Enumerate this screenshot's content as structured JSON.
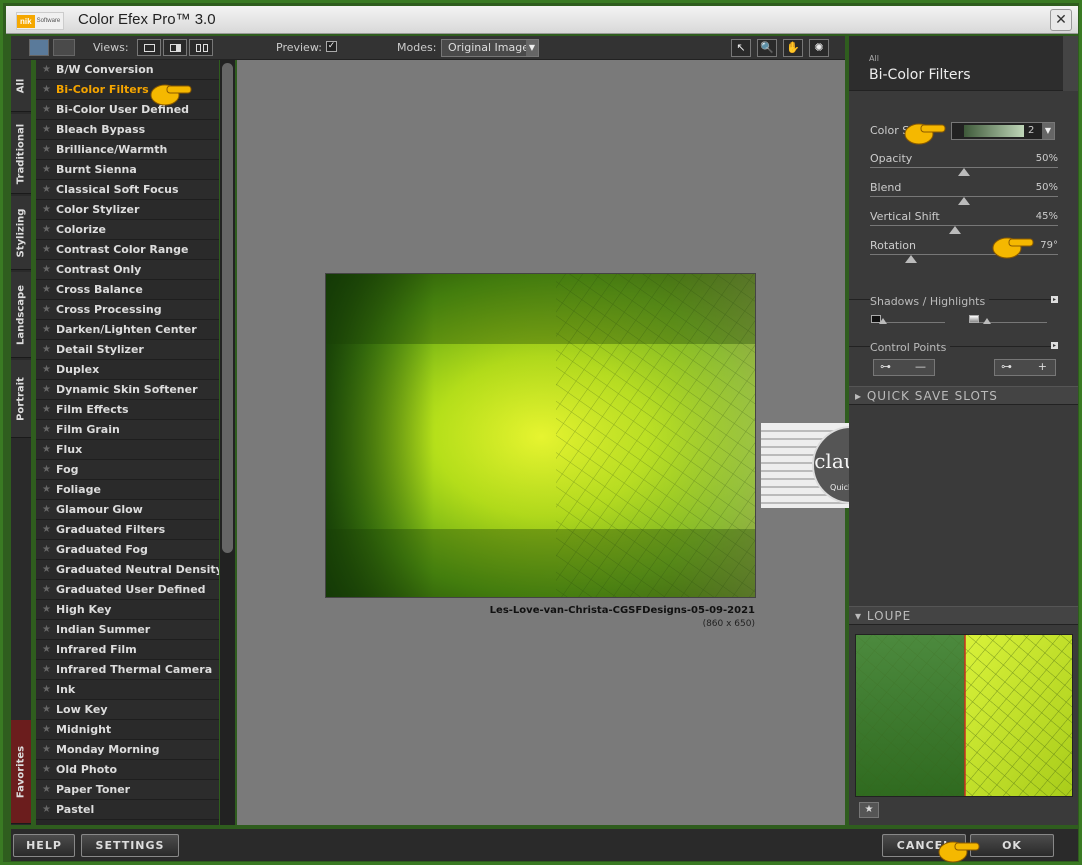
{
  "window": {
    "logo_mark": "nik",
    "logo_sub": "Software",
    "title": "Color Efex Pro™ 3.0",
    "close_glyph": "✕"
  },
  "toolbar": {
    "views_label": "Views:",
    "preview_label": "Preview:",
    "preview_checked_glyph": "✓",
    "modes_label": "Modes:",
    "mode_value": "Original Image",
    "dropdown_glyph": "▼",
    "tools": [
      {
        "name": "pointer-icon",
        "glyph": "↖"
      },
      {
        "name": "zoom-icon",
        "glyph": "🔍"
      },
      {
        "name": "hand-icon",
        "glyph": "✋"
      },
      {
        "name": "light-icon",
        "glyph": "✺"
      }
    ]
  },
  "category_tabs": [
    "All",
    "Traditional",
    "Stylizing",
    "Landscape",
    "Portrait",
    "Favorites"
  ],
  "filters": {
    "selected_index": 1,
    "items": [
      "B/W Conversion",
      "Bi-Color Filters",
      "Bi-Color User Defined",
      "Bleach Bypass",
      "Brilliance/Warmth",
      "Burnt Sienna",
      "Classical Soft Focus",
      "Color Stylizer",
      "Colorize",
      "Contrast Color Range",
      "Contrast Only",
      "Cross Balance",
      "Cross Processing",
      "Darken/Lighten Center",
      "Detail Stylizer",
      "Duplex",
      "Dynamic Skin Softener",
      "Film Effects",
      "Film Grain",
      "Flux",
      "Fog",
      "Foliage",
      "Glamour Glow",
      "Graduated Filters",
      "Graduated Fog",
      "Graduated Neutral Density",
      "Graduated User Defined",
      "High Key",
      "Indian Summer",
      "Infrared Film",
      "Infrared Thermal Camera",
      "Ink",
      "Low Key",
      "Midnight",
      "Monday Morning",
      "Old Photo",
      "Paper Toner",
      "Pastel"
    ]
  },
  "preview": {
    "file_name": "Les-Love-van-Christa-CGSFDesigns-05-09-2021",
    "dimensions": "(860 x 650)"
  },
  "watermark": {
    "name": "claudia",
    "sub": "Quick love"
  },
  "panel": {
    "breadcrumb": "All",
    "title": "Bi-Color Filters",
    "color_set_label": "Color S",
    "color_set_value": "2",
    "sliders": [
      {
        "label": "Opacity",
        "display": "50%",
        "value": 0.5
      },
      {
        "label": "Blend",
        "display": "50%",
        "value": 0.5
      },
      {
        "label": "Vertical Shift",
        "display": "45%",
        "value": 0.45
      },
      {
        "label": "Rotation",
        "display": "79°",
        "value": 0.22
      }
    ],
    "shadows_highlights": "Shadows / Highlights",
    "control_points": "Control Points",
    "cp_remove_glyph": "—",
    "cp_add_glyph": "+",
    "expand_glyph": "▸",
    "collapse_glyph": "▾",
    "quick_save": "QUICK SAVE SLOTS",
    "loupe": "LOUPE",
    "loupe_pin_glyph": "★"
  },
  "bottom": {
    "help": "HELP",
    "settings": "SETTINGS",
    "cancel": "CANCEL",
    "ok": "OK"
  },
  "colors": {
    "accent": "#f5a500",
    "panel_bg": "#3a3a3a",
    "preview_bg": "#7a7a7a"
  }
}
